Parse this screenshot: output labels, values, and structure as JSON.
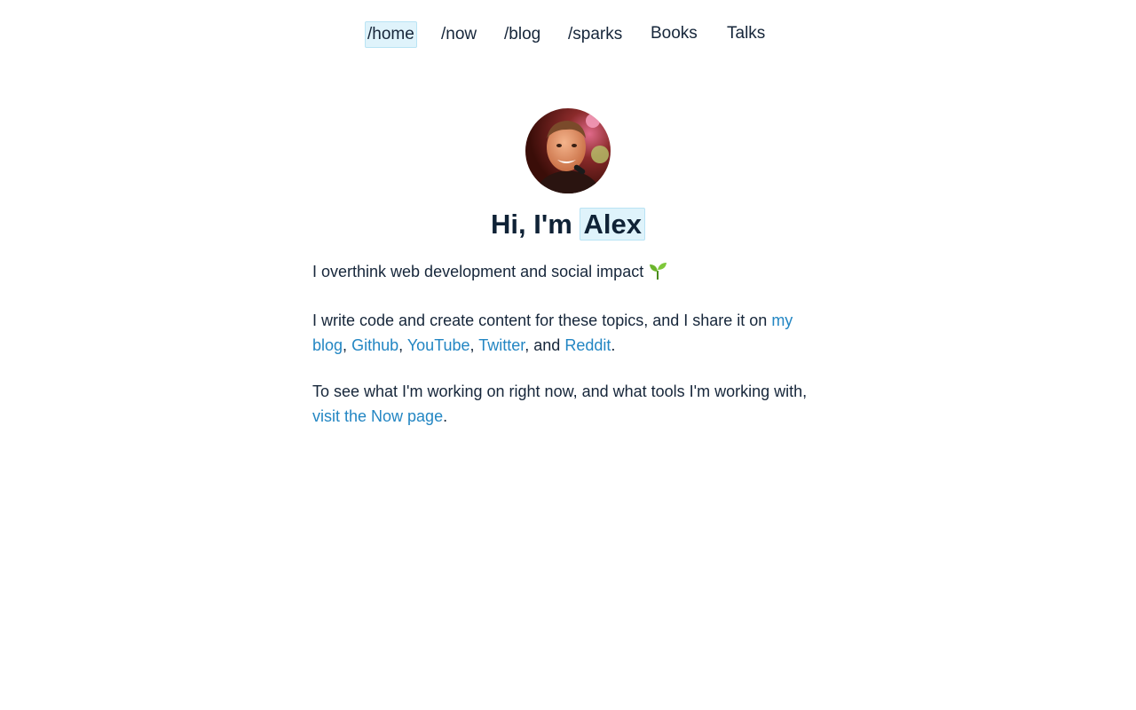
{
  "nav": {
    "items": [
      {
        "label": "/home",
        "active": true
      },
      {
        "label": "/now",
        "active": false
      },
      {
        "label": "/blog",
        "active": false
      },
      {
        "label": "/sparks",
        "active": false
      },
      {
        "label": "Books",
        "active": false
      },
      {
        "label": "Talks",
        "active": false
      }
    ]
  },
  "hero": {
    "greeting": "Hi, I'm",
    "name": "Alex",
    "avatar_icon": "profile-photo"
  },
  "intro": {
    "line1": "I overthink web development and social impact",
    "emoji_icon": "seedling-icon",
    "line2_prefix": "I write code and create content for these topics, and I share it on",
    "links": {
      "blog": "my blog",
      "github": "Github",
      "youtube": "YouTube",
      "twitter": "Twitter",
      "reddit": "Reddit"
    },
    "sep_comma": ",",
    "and_text": ", and",
    "period": ".",
    "line3_prefix": "To see what I'm working on right now, and what tools I'm working with,",
    "now_link": "visit the Now page"
  },
  "colors": {
    "text": "#16263a",
    "link": "#2386c3",
    "highlight_bg": "#dff3fb",
    "highlight_border": "#b9e3f4"
  }
}
